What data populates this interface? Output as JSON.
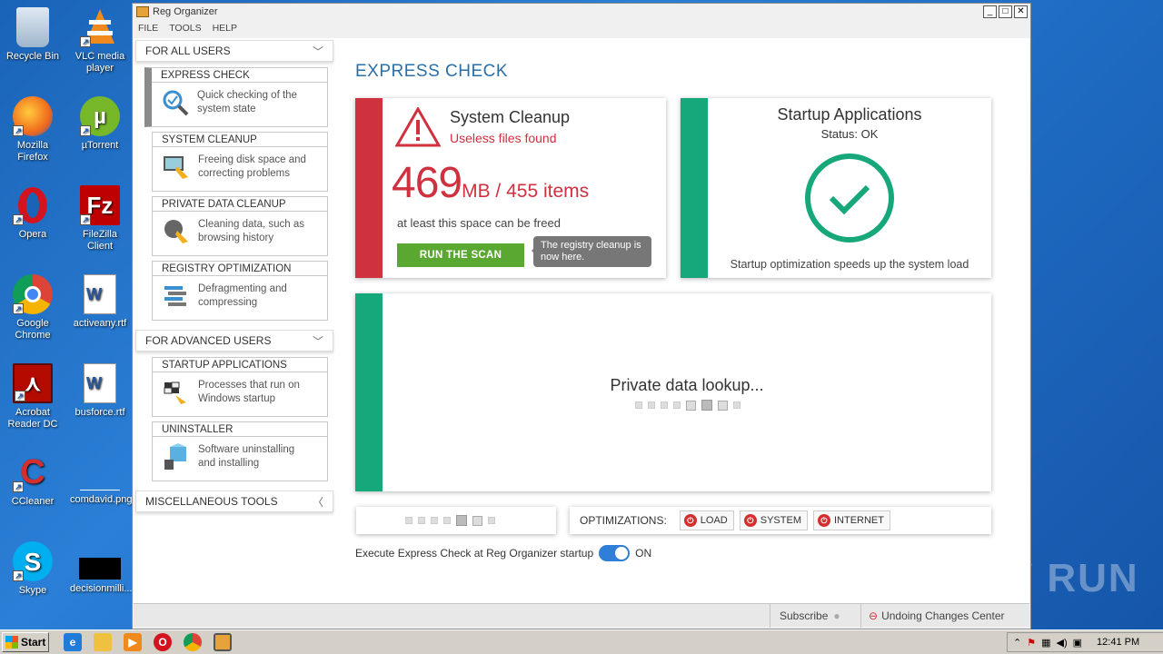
{
  "desktop": {
    "icons": [
      {
        "label": "Recycle Bin",
        "icon": "recycle-bin-icon"
      },
      {
        "label": "VLC media player",
        "icon": "vlc-icon"
      },
      {
        "label": "Mozilla Firefox",
        "icon": "firefox-icon"
      },
      {
        "label": "µTorrent",
        "icon": "utorrent-icon"
      },
      {
        "label": "Opera",
        "icon": "opera-icon"
      },
      {
        "label": "FileZilla Client",
        "icon": "filezilla-icon"
      },
      {
        "label": "Google Chrome",
        "icon": "chrome-icon"
      },
      {
        "label": "activeany.rtf",
        "icon": "word-doc-icon"
      },
      {
        "label": "Acrobat Reader DC",
        "icon": "acrobat-icon"
      },
      {
        "label": "busforce.rtf",
        "icon": "word-doc-icon"
      },
      {
        "label": "CCleaner",
        "icon": "ccleaner-icon"
      },
      {
        "label": "comdavid.png",
        "icon": "image-file-icon"
      },
      {
        "label": "Skype",
        "icon": "skype-icon"
      },
      {
        "label": "decisionmilli...",
        "icon": "black-file-icon"
      }
    ]
  },
  "window": {
    "title": "Reg Organizer",
    "menu": [
      "FILE",
      "TOOLS",
      "HELP"
    ]
  },
  "sidebar": {
    "for_all_users": "FOR ALL USERS",
    "for_advanced_users": "FOR ADVANCED USERS",
    "misc_tools": "MISCELLANEOUS TOOLS",
    "items": [
      {
        "title": "EXPRESS CHECK",
        "desc_1": "Quick checking of the",
        "desc_2": "system state"
      },
      {
        "title": "SYSTEM CLEANUP",
        "desc_1": "Freeing disk space and",
        "desc_2": "correcting problems"
      },
      {
        "title": "PRIVATE DATA CLEANUP",
        "desc_1": "Cleaning data, such as",
        "desc_2": "browsing history"
      },
      {
        "title": "REGISTRY OPTIMIZATION",
        "desc_1": "Defragmenting and",
        "desc_2": "compressing"
      },
      {
        "title": "STARTUP APPLICATIONS",
        "desc_1": "Processes that run on",
        "desc_2": "Windows startup"
      },
      {
        "title": "UNINSTALLER",
        "desc_1": "Software uninstalling",
        "desc_2": "and installing"
      }
    ]
  },
  "main": {
    "title": "EXPRESS CHECK",
    "cleanup": {
      "title": "System Cleanup",
      "subtitle": "Useless files found",
      "size": "469",
      "unit": "MB / 455 items",
      "note": "at least this space can be freed",
      "button": "RUN THE SCAN",
      "tooltip": "The registry cleanup is now here."
    },
    "startup": {
      "title": "Startup Applications",
      "status": "Status: OK",
      "note": "Startup optimization speeds up the system load"
    },
    "private": {
      "text": "Private data lookup..."
    },
    "optimizations": {
      "label": "OPTIMIZATIONS:",
      "buttons": [
        "LOAD",
        "SYSTEM",
        "INTERNET"
      ]
    },
    "startup_check": {
      "label": "Execute Express Check at Reg Organizer startup",
      "state": "ON"
    },
    "colors": {
      "red": "#d0313f",
      "green": "#16a77b",
      "blue": "#2a6fa8",
      "run_green": "#5aa832"
    }
  },
  "statusbar": {
    "subscribe": "Subscribe",
    "undo": "Undoing Changes Center"
  },
  "taskbar": {
    "start": "Start",
    "time": "12:41 PM"
  },
  "watermark": "ANY RUN"
}
